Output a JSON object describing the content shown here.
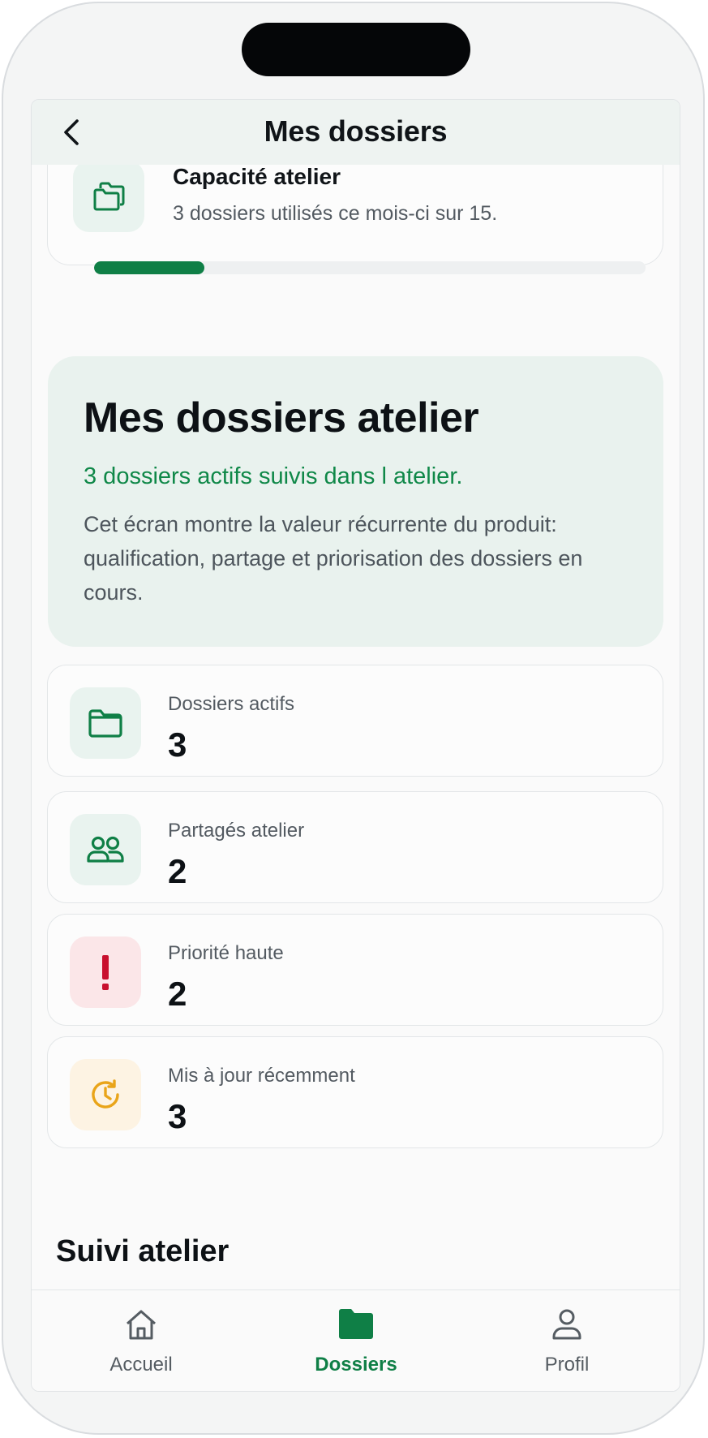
{
  "header": {
    "title": "Mes dossiers"
  },
  "capacity": {
    "title": "Capacité atelier",
    "subtitle": "3 dossiers utilisés ce mois-ci sur 15.",
    "progress_fraction": 0.2
  },
  "hero": {
    "title": "Mes dossiers atelier",
    "subtitle": "3 dossiers actifs suivis dans l atelier.",
    "description": "Cet écran montre la valeur récurrente du produit: qualification, partage et priorisation des dossiers en cours."
  },
  "stats": [
    {
      "label": "Dossiers actifs",
      "value": "3",
      "icon": "folder-icon"
    },
    {
      "label": "Partagés atelier",
      "value": "2",
      "icon": "users-icon"
    },
    {
      "label": "Priorité haute",
      "value": "2",
      "icon": "exclamation-icon"
    },
    {
      "label": "Mis à jour récemment",
      "value": "3",
      "icon": "clock-refresh-icon"
    }
  ],
  "section": {
    "title": "Suivi atelier"
  },
  "tabs": [
    {
      "label": "Accueil",
      "icon": "home-icon",
      "active": false
    },
    {
      "label": "Dossiers",
      "icon": "folder-filled-icon",
      "active": true
    },
    {
      "label": "Profil",
      "icon": "user-icon",
      "active": false
    }
  ],
  "colors": {
    "accent": "#0f7f46",
    "danger": "#c8102e",
    "warning": "#e9a419"
  }
}
